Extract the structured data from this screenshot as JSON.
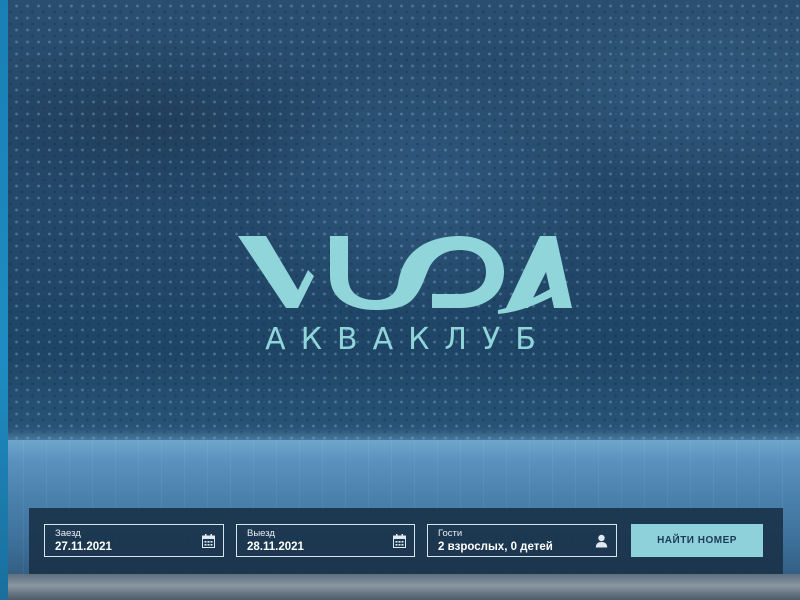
{
  "brand": {
    "logo_text": "VODA",
    "subtitle": "АКВАКЛУБ",
    "logo_color": "#8fd5d9"
  },
  "booking": {
    "checkin": {
      "label": "Заезд",
      "value": "27.11.2021",
      "icon": "calendar-icon"
    },
    "checkout": {
      "label": "Выезд",
      "value": "28.11.2021",
      "icon": "calendar-icon"
    },
    "guests": {
      "label": "Гости",
      "value": "2 взрослых, 0 детей",
      "icon": "person-icon"
    },
    "search_label": "НАЙТИ НОМЕР",
    "button_color": "#8ed1da"
  }
}
